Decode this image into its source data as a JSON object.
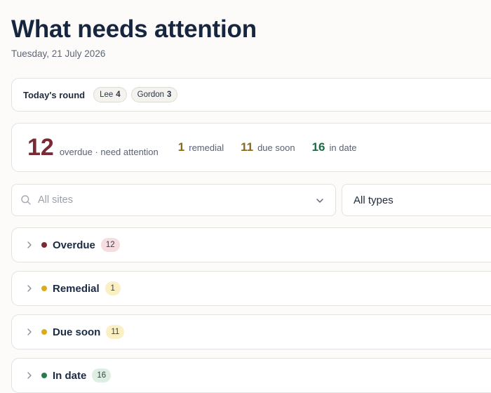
{
  "header": {
    "title": "What needs attention",
    "date": "Tuesday, 21 July 2026"
  },
  "round": {
    "label": "Today's round",
    "people": [
      {
        "name": "Lee",
        "count": "4"
      },
      {
        "name": "Gordon",
        "count": "3"
      }
    ]
  },
  "summary": {
    "overdue": {
      "value": "12",
      "label": "overdue · need attention",
      "color": "#7a2a35"
    },
    "remedial": {
      "value": "1",
      "label": "remedial",
      "color": "#8a6a1a"
    },
    "due_soon": {
      "value": "11",
      "label": "due soon",
      "color": "#8a6a1a"
    },
    "in_date": {
      "value": "16",
      "label": "in date",
      "color": "#1f6a46"
    }
  },
  "filters": {
    "sites_placeholder": "All sites",
    "sites_value": "",
    "types_value": "All types"
  },
  "groups": [
    {
      "label": "Overdue",
      "count": "12",
      "dot_color": "#7a2a35",
      "badge_bg": "#f6dde0",
      "icon": "chevron-right-icon"
    },
    {
      "label": "Remedial",
      "count": "1",
      "dot_color": "#d9ac1c",
      "badge_bg": "#fbefc4",
      "icon": "chevron-right-icon"
    },
    {
      "label": "Due soon",
      "count": "11",
      "dot_color": "#d9ac1c",
      "badge_bg": "#fbefc4",
      "icon": "chevron-right-icon"
    },
    {
      "label": "In date",
      "count": "16",
      "dot_color": "#2a7a4e",
      "badge_bg": "#dcefe2",
      "icon": "chevron-right-icon"
    }
  ]
}
